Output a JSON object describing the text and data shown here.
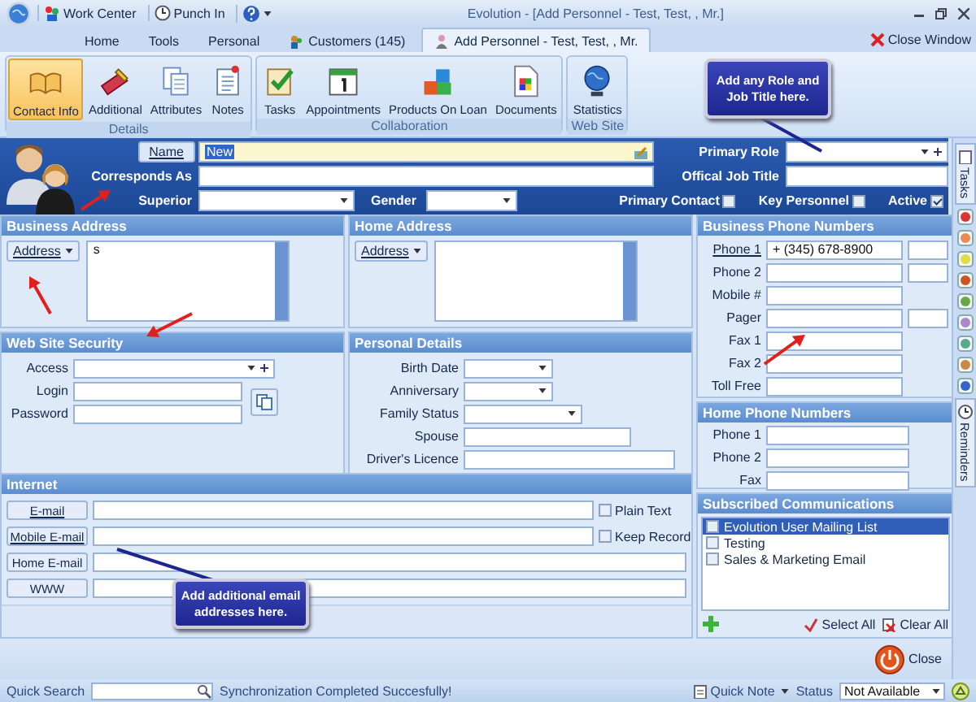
{
  "title_bar": {
    "quick_access": [
      "Work Center",
      "Punch In"
    ],
    "title": "Evolution - [Add Personnel - Test, Test, , Mr.]"
  },
  "tabs": [
    {
      "label": "Home",
      "selected": false
    },
    {
      "label": "Tools",
      "selected": false
    },
    {
      "label": "Personal",
      "selected": false
    },
    {
      "label": "Customers (145)",
      "selected": false
    },
    {
      "label": "Add Personnel - Test, Test, , Mr.",
      "selected": true
    }
  ],
  "close_window": "Close Window",
  "ribbon": {
    "groups": [
      {
        "label": "Details",
        "items": [
          {
            "label": "Contact Info",
            "selected": true
          },
          {
            "label": "Additional",
            "selected": false
          },
          {
            "label": "Attributes",
            "selected": false
          },
          {
            "label": "Notes",
            "selected": false
          }
        ]
      },
      {
        "label": "Collaboration",
        "items": [
          {
            "label": "Tasks",
            "selected": false
          },
          {
            "label": "Appointments",
            "selected": false
          },
          {
            "label": "Products On Loan",
            "selected": false
          },
          {
            "label": "Documents",
            "selected": false
          }
        ]
      },
      {
        "label": "Web Site",
        "items": [
          {
            "label": "Statistics",
            "selected": false
          }
        ]
      }
    ]
  },
  "header": {
    "name": {
      "label": "Name",
      "value": "New"
    },
    "corresponds_as": {
      "label": "Corresponds As"
    },
    "superior": {
      "label": "Superior"
    },
    "gender": {
      "label": "Gender"
    },
    "primary_role": {
      "label": "Primary Role"
    },
    "job_title": {
      "label": "Offical Job Title"
    },
    "checks": [
      {
        "label": "Primary Contact",
        "checked": false
      },
      {
        "label": "Key Personnel",
        "checked": false
      },
      {
        "label": "Active",
        "checked": true
      }
    ]
  },
  "business_address": {
    "title": "Business Address",
    "type_button": "Address",
    "value": "s"
  },
  "home_address": {
    "title": "Home Address",
    "type_button": "Address"
  },
  "web_site_security": {
    "title": "Web Site Security",
    "fields": [
      {
        "label": "Access",
        "kind": "combo"
      },
      {
        "label": "Login",
        "kind": "text"
      },
      {
        "label": "Password",
        "kind": "text"
      }
    ]
  },
  "personal_details": {
    "title": "Personal Details",
    "fields": [
      {
        "label": "Birth Date",
        "kind": "date"
      },
      {
        "label": "Anniversary",
        "kind": "date"
      },
      {
        "label": "Family Status",
        "kind": "dropdown"
      },
      {
        "label": "Spouse",
        "kind": "text"
      },
      {
        "label": "Driver's Licence",
        "kind": "long"
      }
    ]
  },
  "internet": {
    "title": "Internet",
    "rows": [
      {
        "label": "E-mail",
        "link": true,
        "option": {
          "label": "Plain Text",
          "checked": false
        }
      },
      {
        "label": "Mobile E-mail",
        "link": true,
        "option": {
          "label": "Keep Record",
          "checked": false
        }
      },
      {
        "label": "Home E-mail",
        "link": false
      },
      {
        "label": "WWW",
        "link": false
      }
    ]
  },
  "business_phones": {
    "title": "Business Phone Numbers",
    "rows": [
      {
        "label": "Phone 1",
        "link": true,
        "value": "+ (345) 678-8900",
        "extension": true
      },
      {
        "label": "Phone 2",
        "link": false,
        "extension": true
      },
      {
        "label": "Mobile #",
        "link": false,
        "extension": false
      },
      {
        "label": "Pager",
        "link": false,
        "extension": true
      },
      {
        "label": "Fax 1",
        "link": false,
        "extension": false
      },
      {
        "label": "Fax 2",
        "link": false,
        "extension": false
      },
      {
        "label": "Toll Free",
        "link": false,
        "extension": false
      }
    ]
  },
  "home_phones": {
    "title": "Home Phone Numbers",
    "rows": [
      {
        "label": "Phone 1"
      },
      {
        "label": "Phone 2"
      },
      {
        "label": "Fax"
      }
    ]
  },
  "subscribed": {
    "title": "Subscribed Communications",
    "items": [
      {
        "label": "Evolution User Mailing List",
        "checked": false,
        "selected": true
      },
      {
        "label": "Testing",
        "checked": false,
        "selected": false
      },
      {
        "label": "Sales & Marketing Email",
        "checked": false,
        "selected": false
      }
    ],
    "select_all": "Select All",
    "clear_all": "Clear All"
  },
  "close": "Close",
  "side_tabs": [
    "Tasks",
    "Reminders"
  ],
  "status_bar": {
    "quick_search": "Quick Search",
    "message": "Synchronization Completed Succesfully!",
    "quick_note": "Quick Note",
    "status_label": "Status",
    "status_value": "Not Available"
  },
  "callouts": [
    {
      "text": "Add any Role and Job Title here."
    },
    {
      "text": "Add additional email addresses here."
    }
  ]
}
